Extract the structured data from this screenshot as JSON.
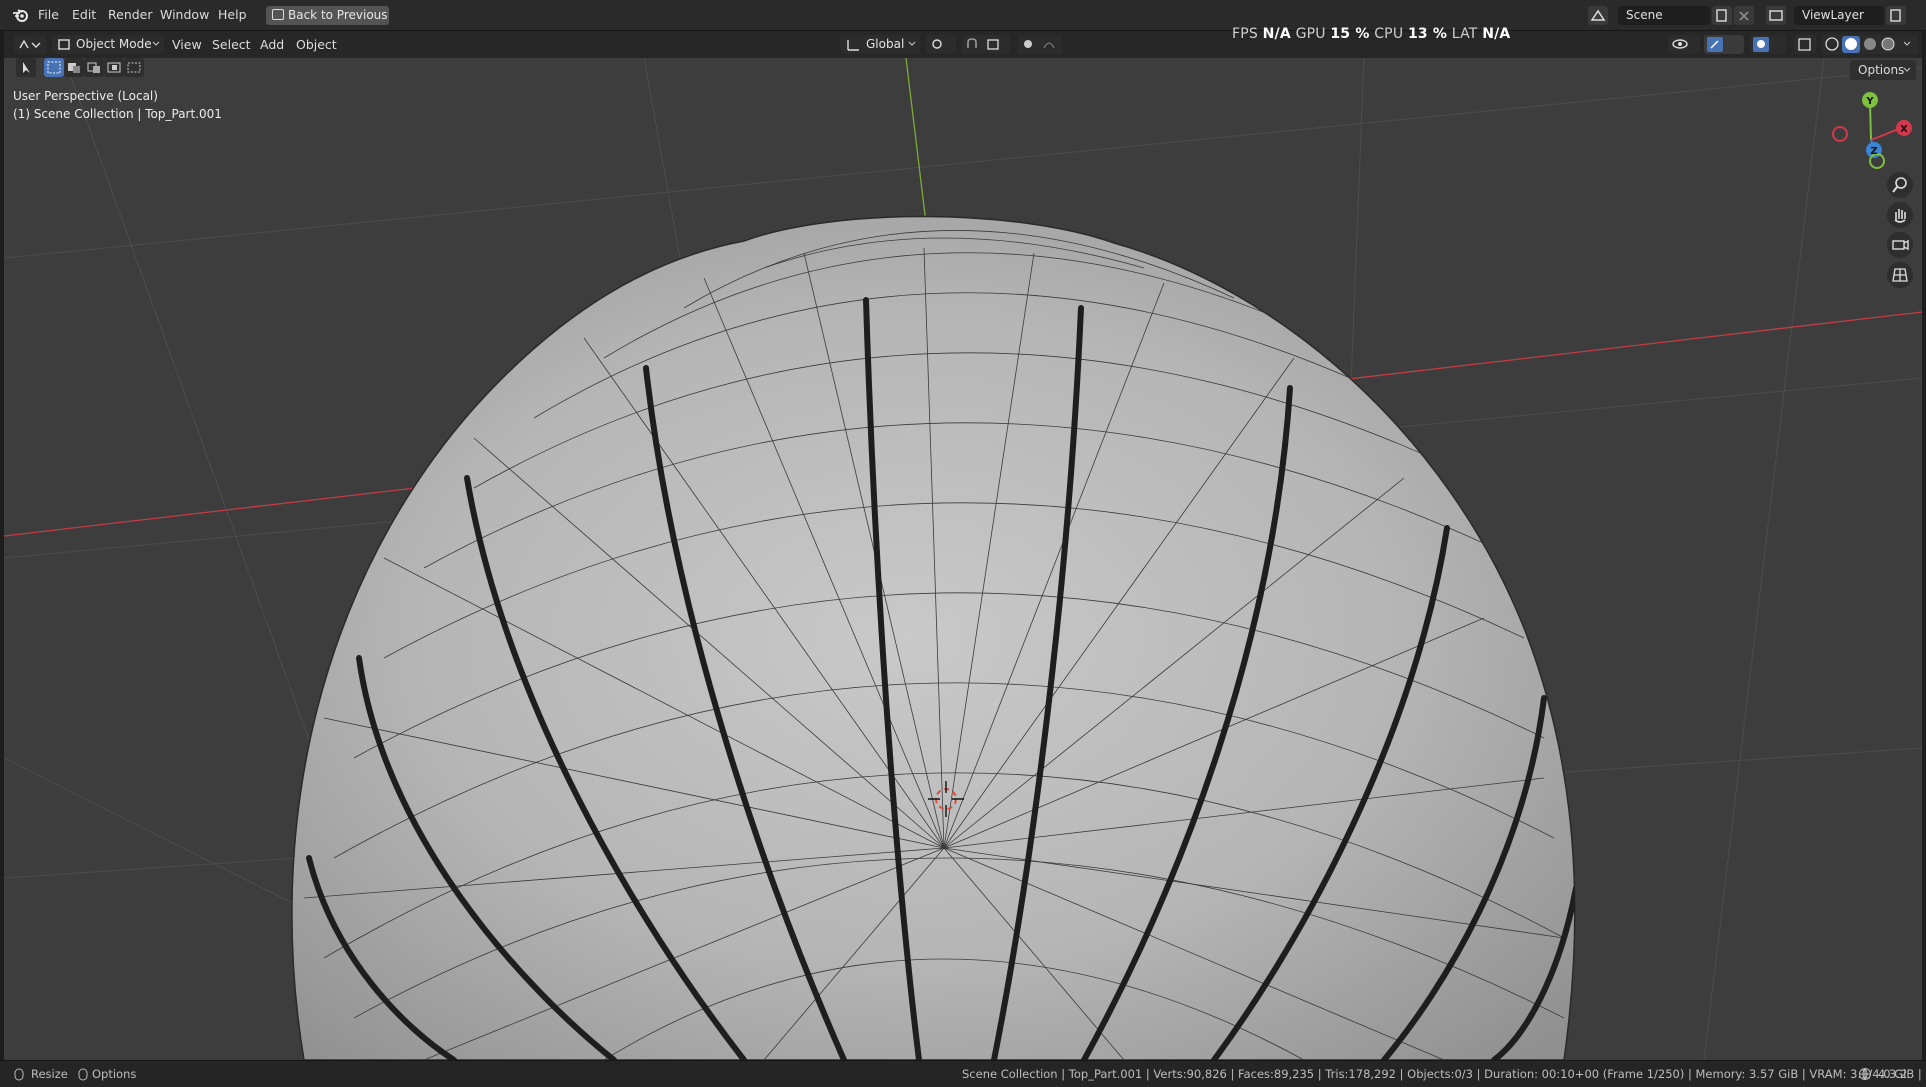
{
  "menubar": {
    "items": [
      "File",
      "Edit",
      "Render",
      "Window",
      "Help"
    ],
    "back_button": "Back to Previous",
    "scene_field": "Scene",
    "viewlayer_field": "ViewLayer"
  },
  "header": {
    "mode": "Object Mode",
    "menus": [
      "View",
      "Select",
      "Add",
      "Object"
    ],
    "orientation": "Global"
  },
  "stats": {
    "fps_label": "FPS",
    "fps_value": "N/A",
    "gpu_label": "GPU",
    "gpu_value": "15 %",
    "cpu_label": "CPU",
    "cpu_value": "13 %",
    "lat_label": "LAT",
    "lat_value": "N/A"
  },
  "viewport": {
    "perspective": "User Perspective (Local)",
    "collection": "(1) Scene Collection | Top_Part.001",
    "options_label": "Options",
    "gizmo": {
      "y": "Y",
      "x": "X",
      "z": "Z"
    }
  },
  "statusbar": {
    "resize": "Resize",
    "options": "Options",
    "info": "Scene Collection | Top_Part.001 | Verts:90,826 | Faces:89,235 | Tris:178,292 | Objects:0/3 | Duration: 00:10+00 (Frame 1/250) | Memory: 3.57 GiB | VRAM: 3.1/4.0 GiB |",
    "version": "4.3.2"
  },
  "colors": {
    "x_axis": "#d2394a",
    "y_axis": "#8cc63f",
    "z_axis": "#3a84d6",
    "selected_tool": "#4772b3",
    "viewport_bg": "#3d3d3d"
  },
  "icons": {
    "logo": "blender-logo-icon",
    "cursor": "3d-cursor-icon",
    "zoom": "zoom-icon",
    "pan": "hand-icon",
    "camera": "camera-icon",
    "grid": "grid-icon"
  }
}
